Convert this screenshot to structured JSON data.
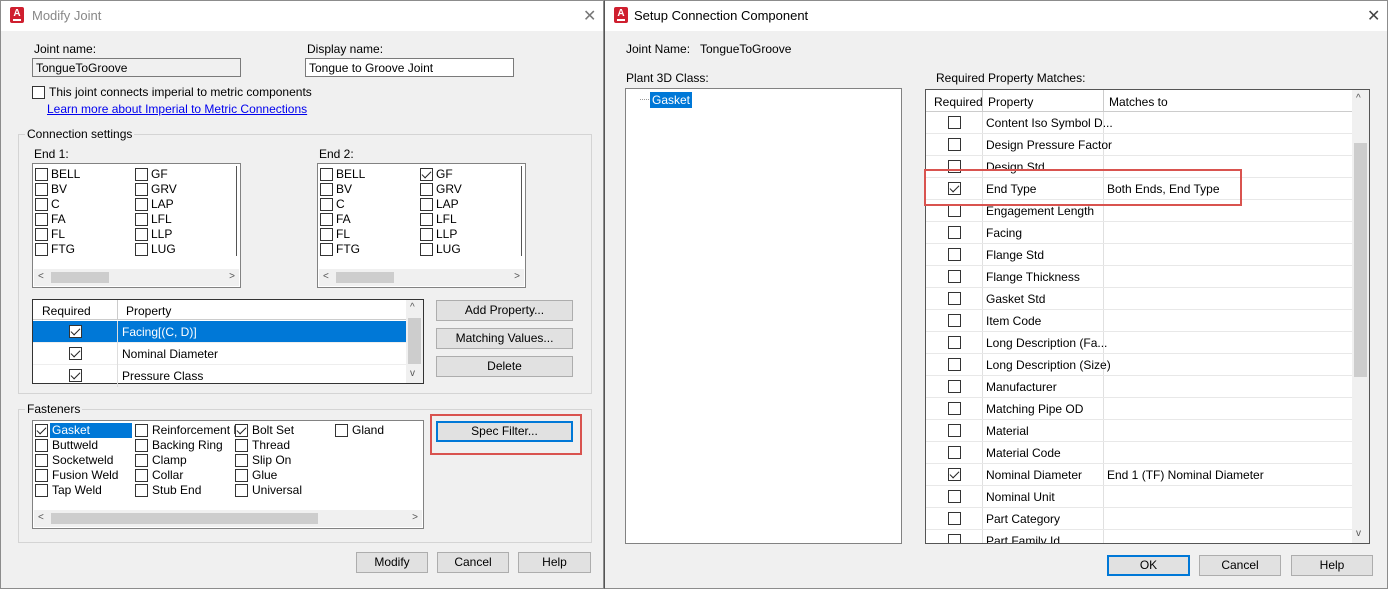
{
  "left": {
    "title": "Modify Joint",
    "joint_name_label": "Joint name:",
    "joint_name": "TongueToGroove",
    "display_name_label": "Display name:",
    "display_name": "Tongue to Groove Joint",
    "imperial_label": "This joint connects imperial to metric components",
    "learn_link": "Learn more about Imperial to Metric Connections",
    "conn_settings": "Connection settings",
    "end1_label": "End 1:",
    "end2_label": "End 2:",
    "end1_col1": [
      {
        "label": "BELL",
        "checked": false
      },
      {
        "label": "BV",
        "checked": false
      },
      {
        "label": "C",
        "checked": false
      },
      {
        "label": "FA",
        "checked": false
      },
      {
        "label": "FL",
        "checked": false
      },
      {
        "label": "FTG",
        "checked": false
      }
    ],
    "end1_col2": [
      {
        "label": "GF",
        "checked": false
      },
      {
        "label": "GRV",
        "checked": false
      },
      {
        "label": "LAP",
        "checked": false
      },
      {
        "label": "LFL",
        "checked": false
      },
      {
        "label": "LLP",
        "checked": false
      },
      {
        "label": "LUG",
        "checked": false
      }
    ],
    "end2_col1": [
      {
        "label": "BELL",
        "checked": false
      },
      {
        "label": "BV",
        "checked": false
      },
      {
        "label": "C",
        "checked": false
      },
      {
        "label": "FA",
        "checked": false
      },
      {
        "label": "FL",
        "checked": false
      },
      {
        "label": "FTG",
        "checked": false
      }
    ],
    "end2_col2": [
      {
        "label": "GF",
        "checked": true
      },
      {
        "label": "GRV",
        "checked": false
      },
      {
        "label": "LAP",
        "checked": false
      },
      {
        "label": "LFL",
        "checked": false
      },
      {
        "label": "LLP",
        "checked": false
      },
      {
        "label": "LUG",
        "checked": false
      }
    ],
    "prop_table": {
      "headers": [
        "Required",
        "Property"
      ],
      "rows": [
        {
          "required": true,
          "property": "Facing[(C, D)]",
          "selected": true
        },
        {
          "required": true,
          "property": "Nominal Diameter",
          "selected": false
        },
        {
          "required": true,
          "property": "Pressure Class",
          "selected": false
        }
      ]
    },
    "add_property": "Add Property...",
    "matching_values": "Matching Values...",
    "delete": "Delete",
    "fasteners": "Fasteners",
    "fast_cols": [
      [
        {
          "label": "Gasket",
          "checked": true,
          "selected": true
        },
        {
          "label": "Buttweld",
          "checked": false
        },
        {
          "label": "Socketweld",
          "checked": false
        },
        {
          "label": "Fusion Weld",
          "checked": false
        },
        {
          "label": "Tap Weld",
          "checked": false
        }
      ],
      [
        {
          "label": "Reinforcement R",
          "checked": false
        },
        {
          "label": "Backing Ring",
          "checked": false
        },
        {
          "label": "Clamp",
          "checked": false
        },
        {
          "label": "Collar",
          "checked": false
        },
        {
          "label": "Stub End",
          "checked": false
        }
      ],
      [
        {
          "label": "Bolt Set",
          "checked": true
        },
        {
          "label": "Thread",
          "checked": false
        },
        {
          "label": "Slip On",
          "checked": false
        },
        {
          "label": "Glue",
          "checked": false
        },
        {
          "label": "Universal",
          "checked": false
        }
      ],
      [
        {
          "label": "Gland",
          "checked": false
        }
      ]
    ],
    "spec_filter": "Spec Filter...",
    "modify": "Modify",
    "cancel": "Cancel",
    "help": "Help"
  },
  "right": {
    "title": "Setup Connection Component",
    "joint_name_label": "Joint Name:",
    "joint_name": "TongueToGroove",
    "class_label": "Plant 3D Class:",
    "tree_item": "Gasket",
    "req_label": "Required Property Matches:",
    "headers": [
      "Required",
      "Property",
      "Matches to"
    ],
    "rows": [
      {
        "required": false,
        "property": "Content Iso Symbol D...",
        "matches": ""
      },
      {
        "required": false,
        "property": "Design Pressure Factor",
        "matches": ""
      },
      {
        "required": false,
        "property": "Design Std",
        "matches": ""
      },
      {
        "required": true,
        "property": "End Type",
        "matches": "Both Ends, End Type"
      },
      {
        "required": false,
        "property": "Engagement Length",
        "matches": ""
      },
      {
        "required": false,
        "property": "Facing",
        "matches": ""
      },
      {
        "required": false,
        "property": "Flange Std",
        "matches": ""
      },
      {
        "required": false,
        "property": "Flange Thickness",
        "matches": ""
      },
      {
        "required": false,
        "property": "Gasket Std",
        "matches": ""
      },
      {
        "required": false,
        "property": "Item Code",
        "matches": ""
      },
      {
        "required": false,
        "property": "Long Description (Fa...",
        "matches": ""
      },
      {
        "required": false,
        "property": "Long Description (Size)",
        "matches": ""
      },
      {
        "required": false,
        "property": "Manufacturer",
        "matches": ""
      },
      {
        "required": false,
        "property": "Matching Pipe OD",
        "matches": ""
      },
      {
        "required": false,
        "property": "Material",
        "matches": ""
      },
      {
        "required": false,
        "property": "Material Code",
        "matches": ""
      },
      {
        "required": true,
        "property": "Nominal Diameter",
        "matches": "End 1 (TF) Nominal Diameter"
      },
      {
        "required": false,
        "property": "Nominal Unit",
        "matches": ""
      },
      {
        "required": false,
        "property": "Part Category",
        "matches": ""
      },
      {
        "required": false,
        "property": "Part Family Id",
        "matches": ""
      }
    ],
    "ok": "OK",
    "cancel": "Cancel",
    "help": "Help"
  }
}
